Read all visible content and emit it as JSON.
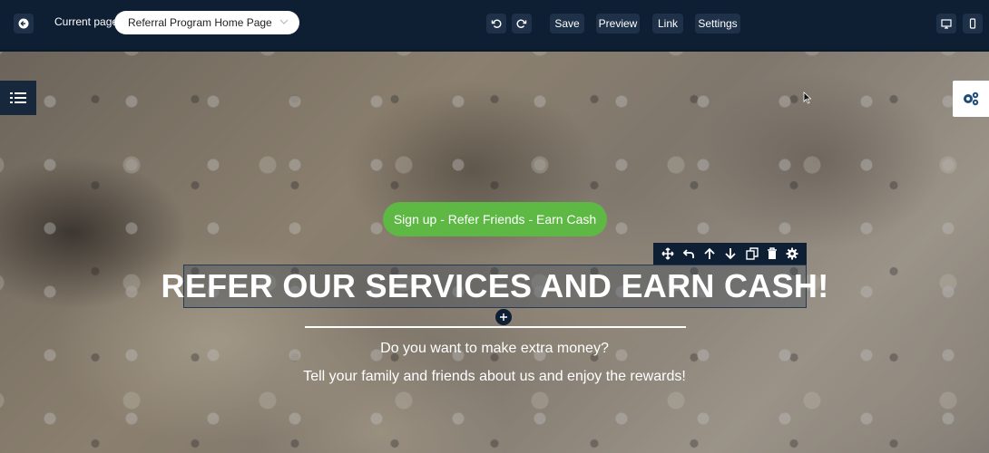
{
  "topbar": {
    "current_page_label": "Current page",
    "page_select_value": "Referral Program Home Page",
    "save_label": "Save",
    "preview_label": "Preview",
    "link_label": "Link",
    "settings_label": "Settings",
    "icons": [
      "back-arrow-icon",
      "undo-icon",
      "redo-icon",
      "desktop-icon",
      "mobile-icon"
    ]
  },
  "canvas": {
    "cta_label": "Sign up - Refer Friends - Earn Cash",
    "heading": "REFER OUR SERVICES AND EARN CASH!",
    "subtitle_1": "Do you want to make extra money?",
    "subtitle_2": "Tell your family and friends about us and enjoy the rewards!",
    "element_toolbar_icons": [
      "move-icon",
      "undo-icon",
      "arrow-up-icon",
      "arrow-down-icon",
      "duplicate-icon",
      "trash-icon",
      "gear-icon"
    ]
  },
  "colors": {
    "topbar_bg": "#0e1f33",
    "button_bg": "#1e3149",
    "cta_green": "#5eb944",
    "text_white": "#ffffff"
  }
}
